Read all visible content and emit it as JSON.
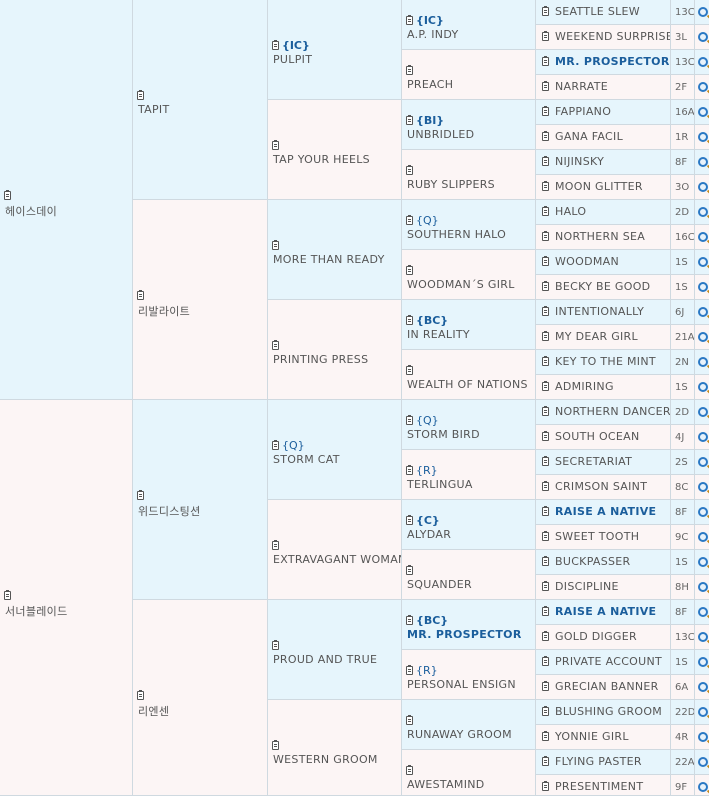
{
  "gen1": [
    {
      "name": "헤이스데이"
    },
    {
      "name": "서너블레이드"
    }
  ],
  "gen2": [
    {
      "name": "TAPIT"
    },
    {
      "name": "리발라이트"
    },
    {
      "name": "위드디스팅션"
    },
    {
      "name": "리엔센"
    }
  ],
  "gen3": [
    {
      "name": "PULPIT",
      "badge": "{IC}"
    },
    {
      "name": "TAP YOUR HEELS"
    },
    {
      "name": "MORE THAN READY"
    },
    {
      "name": "PRINTING PRESS"
    },
    {
      "name": "STORM CAT",
      "badge": "{Q}"
    },
    {
      "name": "EXTRAVAGANT WOMAN"
    },
    {
      "name": "PROUD AND TRUE"
    },
    {
      "name": "WESTERN GROOM"
    }
  ],
  "gen4": [
    {
      "name": "A.P. INDY",
      "badge": "{IC}"
    },
    {
      "name": "PREACH"
    },
    {
      "name": "UNBRIDLED",
      "badge": "{BI}"
    },
    {
      "name": "RUBY SLIPPERS"
    },
    {
      "name": "SOUTHERN HALO",
      "badge": "{Q}"
    },
    {
      "name": "WOODMAN´S GIRL"
    },
    {
      "name": "IN REALITY",
      "badge": "{BC}"
    },
    {
      "name": "WEALTH OF NATIONS"
    },
    {
      "name": "STORM BIRD",
      "badge": "{Q}"
    },
    {
      "name": "TERLINGUA",
      "badge": "{R}"
    },
    {
      "name": "ALYDAR",
      "badge": "{C}"
    },
    {
      "name": "SQUANDER"
    },
    {
      "name": "MR. PROSPECTOR",
      "badge": "{BC}",
      "highlight": true
    },
    {
      "name": "PERSONAL ENSIGN",
      "badge": "{R}"
    },
    {
      "name": "RUNAWAY GROOM"
    },
    {
      "name": "AWESTAMIND"
    }
  ],
  "gen5": [
    {
      "name": "SEATTLE SLEW",
      "sire": "13C"
    },
    {
      "name": "WEEKEND SURPRISE",
      "sire": "3L"
    },
    {
      "name": "MR. PROSPECTOR",
      "sire": "13C",
      "highlight": true
    },
    {
      "name": "NARRATE",
      "sire": "2F"
    },
    {
      "name": "FAPPIANO",
      "sire": "16A"
    },
    {
      "name": "GANA FACIL",
      "sire": "1R"
    },
    {
      "name": "NIJINSKY",
      "sire": "8F"
    },
    {
      "name": "MOON GLITTER",
      "sire": "3O"
    },
    {
      "name": "HALO",
      "sire": "2D"
    },
    {
      "name": "NORTHERN SEA",
      "sire": "16C"
    },
    {
      "name": "WOODMAN",
      "sire": "1S"
    },
    {
      "name": "BECKY BE GOOD",
      "sire": "1S"
    },
    {
      "name": "INTENTIONALLY",
      "sire": "6J"
    },
    {
      "name": "MY DEAR GIRL",
      "sire": "21A"
    },
    {
      "name": "KEY TO THE MINT",
      "sire": "2N"
    },
    {
      "name": "ADMIRING",
      "sire": "1S"
    },
    {
      "name": "NORTHERN DANCER",
      "sire": "2D"
    },
    {
      "name": "SOUTH OCEAN",
      "sire": "4J"
    },
    {
      "name": "SECRETARIAT",
      "sire": "2S"
    },
    {
      "name": "CRIMSON SAINT",
      "sire": "8C"
    },
    {
      "name": "RAISE A NATIVE",
      "sire": "8F",
      "highlight": true
    },
    {
      "name": "SWEET TOOTH",
      "sire": "9C"
    },
    {
      "name": "BUCKPASSER",
      "sire": "1S"
    },
    {
      "name": "DISCIPLINE",
      "sire": "8H"
    },
    {
      "name": "RAISE A NATIVE",
      "sire": "8F",
      "highlight": true
    },
    {
      "name": "GOLD DIGGER",
      "sire": "13C"
    },
    {
      "name": "PRIVATE ACCOUNT",
      "sire": "1S"
    },
    {
      "name": "GRECIAN BANNER",
      "sire": "6A"
    },
    {
      "name": "BLUSHING GROOM",
      "sire": "22D"
    },
    {
      "name": "YONNIE GIRL",
      "sire": "4R"
    },
    {
      "name": "FLYING PASTER",
      "sire": "22A"
    },
    {
      "name": "PRESENTIMENT",
      "sire": "9F"
    }
  ],
  "icons": {
    "record": "clipboard-icon",
    "search": "search-icon"
  },
  "colors": {
    "blue_cell": "#e6f5fc",
    "pink_cell": "#fcf5f5",
    "highlight": "#1b5e9c",
    "border": "#cfd9e0"
  }
}
